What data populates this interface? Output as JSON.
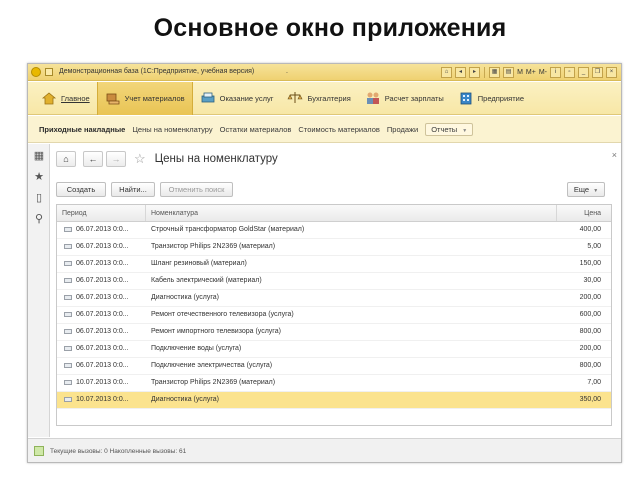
{
  "slide": {
    "title": "Основное окно приложения"
  },
  "window": {
    "caption": "Демонстрационная база  (1С:Предприятие, учебная версия)",
    "dot": ".",
    "tools": [
      "M",
      "M+",
      "M-"
    ],
    "toolbar_icons": [
      "home-icon",
      "back-icon",
      "forward-icon",
      "calculator-icon",
      "calendar-icon",
      "info-icon",
      "window-icon",
      "minimize-icon",
      "restore-icon",
      "close-icon"
    ]
  },
  "sections": [
    {
      "label": "Главное",
      "icon": "home-icon",
      "color": "#d8a623"
    },
    {
      "label": "Учет материалов",
      "icon": "hand-icon",
      "color": "#c07a34"
    },
    {
      "label": "Оказание услуг",
      "icon": "printer-icon",
      "color": "#4a8fb3"
    },
    {
      "label": "Бухгалтерия",
      "icon": "scales-icon",
      "color": "#8a6a2a"
    },
    {
      "label": "Расчет зарплаты",
      "icon": "people-icon",
      "color": "#6b8fb6"
    },
    {
      "label": "Предприятие",
      "icon": "building-icon",
      "color": "#3a86c8"
    }
  ],
  "navigation": {
    "items": [
      "Приходные накладные",
      "Цены на номенклатуру",
      "Остатки материалов",
      "Стоимость материалов",
      "Продажи"
    ],
    "reports": "Отчеты"
  },
  "form": {
    "title": "Цены на номенклатуру",
    "close": "×",
    "buttons": {
      "create": "Создать",
      "find": "Найти...",
      "cancel_search": "Отменить поиск",
      "more": "Еще"
    },
    "columns": [
      "Период",
      "Номенклатура",
      "Цена"
    ],
    "rows": [
      {
        "period": "06.07.2013 0:0...",
        "item": "Строчный трансформатор GoldStar (материал)",
        "price": "400,00"
      },
      {
        "period": "06.07.2013 0:0...",
        "item": "Транзистор Philips 2N2369 (материал)",
        "price": "5,00"
      },
      {
        "period": "06.07.2013 0:0...",
        "item": "Шланг резиновый (материал)",
        "price": "150,00"
      },
      {
        "period": "06.07.2013 0:0...",
        "item": "Кабель электрический (материал)",
        "price": "30,00"
      },
      {
        "period": "06.07.2013 0:0...",
        "item": "Диагностика (услуга)",
        "price": "200,00"
      },
      {
        "period": "06.07.2013 0:0...",
        "item": "Ремонт отечественного телевизора (услуга)",
        "price": "600,00"
      },
      {
        "period": "06.07.2013 0:0...",
        "item": "Ремонт импортного телевизора (услуга)",
        "price": "800,00"
      },
      {
        "period": "06.07.2013 0:0...",
        "item": "Подключение воды (услуга)",
        "price": "200,00"
      },
      {
        "period": "06.07.2013 0:0...",
        "item": "Подключение электричества (услуга)",
        "price": "800,00"
      },
      {
        "period": "10.07.2013 0:0...",
        "item": "Транзистор Philips 2N2369 (материал)",
        "price": "7,00"
      },
      {
        "period": "10.07.2013 0:0...",
        "item": "Диагностика (услуга)",
        "price": "350,00",
        "selected": true
      }
    ],
    "pager": [
      "⇤",
      "▲",
      "▼",
      "⇥"
    ]
  },
  "status": {
    "text": "Текущие вызовы: 0   Накопленные вызовы: 61"
  },
  "colors": {
    "accent": "#f0d274",
    "selected_row": "#fbe38e",
    "panel": "#fbf3d1"
  }
}
